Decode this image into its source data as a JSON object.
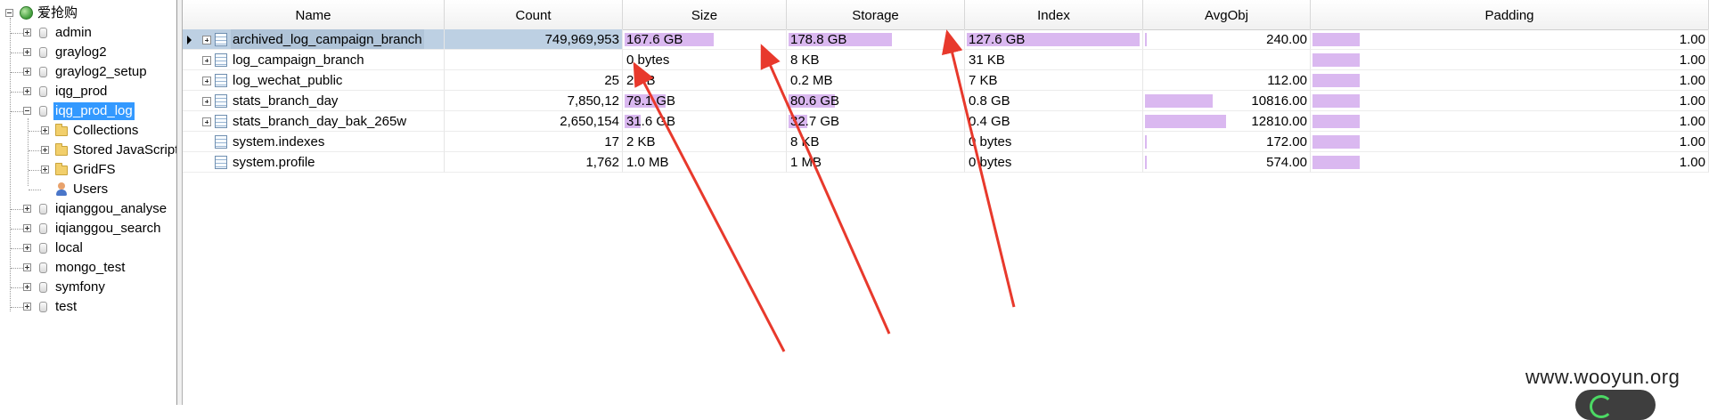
{
  "tree": {
    "root": "爱抢购",
    "databases": [
      "admin",
      "graylog2",
      "graylog2_setup",
      "iqg_prod",
      "iqg_prod_log",
      "iqianggou_analyse",
      "iqianggou_search",
      "local",
      "mongo_test",
      "symfony",
      "test"
    ],
    "selected_db": "iqg_prod_log",
    "children": [
      "Collections",
      "Stored JavaScript",
      "GridFS",
      "Users"
    ]
  },
  "grid": {
    "columns": [
      "Name",
      "Count",
      "Size",
      "Storage",
      "Index",
      "AvgObj",
      "Padding"
    ],
    "rows": [
      {
        "name": "archived_log_campaign_branch",
        "count": "749,969,953",
        "size": "167.6 GB",
        "storage": "178.8 GB",
        "index": "127.6 GB",
        "avgobj": "240.00",
        "padding": "1.00",
        "expandable": true,
        "selected": true,
        "size_fill": 0.56,
        "storage_fill": 0.6,
        "index_fill": 1.0,
        "avgobj_fill": 0.01,
        "padding_fill": 0.12
      },
      {
        "name": "log_campaign_branch",
        "count": "",
        "size": "0 bytes",
        "storage": "8 KB",
        "index": "31 KB",
        "avgobj": "",
        "padding": "1.00",
        "expandable": true,
        "selected": false,
        "size_fill": 0.0,
        "storage_fill": 0.0,
        "index_fill": 0.0,
        "avgobj_fill": 0.0,
        "padding_fill": 0.12
      },
      {
        "name": "log_wechat_public",
        "count": "25",
        "size": "2 KB",
        "storage": "0.2 MB",
        "index": "7 KB",
        "avgobj": "112.00",
        "padding": "1.00",
        "expandable": true,
        "selected": false,
        "size_fill": 0.0,
        "storage_fill": 0.0,
        "index_fill": 0.0,
        "avgobj_fill": 0.0,
        "padding_fill": 0.12
      },
      {
        "name": "stats_branch_day",
        "count": "7,850,12",
        "size": "79.1 GB",
        "storage": "80.6 GB",
        "index": "0.8 GB",
        "avgobj": "10816.00",
        "padding": "1.00",
        "expandable": true,
        "selected": false,
        "size_fill": 0.26,
        "storage_fill": 0.27,
        "index_fill": 0.0,
        "avgobj_fill": 0.42,
        "padding_fill": 0.12
      },
      {
        "name": "stats_branch_day_bak_265w",
        "count": "2,650,154",
        "size": "31.6 GB",
        "storage": "32.7 GB",
        "index": "0.4 GB",
        "avgobj": "12810.00",
        "padding": "1.00",
        "expandable": true,
        "selected": false,
        "size_fill": 0.1,
        "storage_fill": 0.11,
        "index_fill": 0.0,
        "avgobj_fill": 0.5,
        "padding_fill": 0.12
      },
      {
        "name": "system.indexes",
        "count": "17",
        "size": "2 KB",
        "storage": "8 KB",
        "index": "0 bytes",
        "avgobj": "172.00",
        "padding": "1.00",
        "expandable": false,
        "selected": false,
        "size_fill": 0.0,
        "storage_fill": 0.0,
        "index_fill": 0.0,
        "avgobj_fill": 0.01,
        "padding_fill": 0.12
      },
      {
        "name": "system.profile",
        "count": "1,762",
        "size": "1.0 MB",
        "storage": "1 MB",
        "index": "0 bytes",
        "avgobj": "574.00",
        "padding": "1.00",
        "expandable": false,
        "selected": false,
        "size_fill": 0.0,
        "storage_fill": 0.0,
        "index_fill": 0.0,
        "avgobj_fill": 0.01,
        "padding_fill": 0.12
      }
    ]
  },
  "annotation": {
    "arrow_color": "#e8392c"
  },
  "watermark": "www.wooyun.org"
}
